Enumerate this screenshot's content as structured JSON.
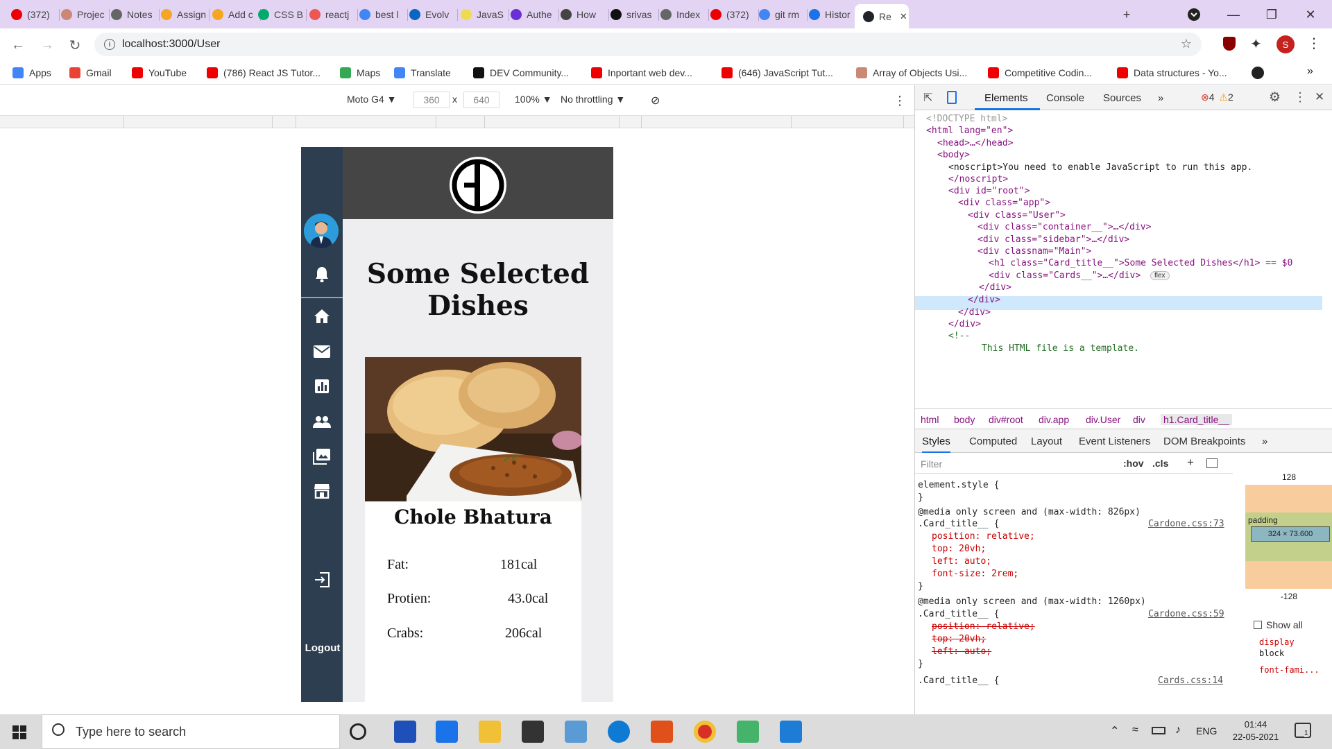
{
  "browser": {
    "tabs": [
      {
        "label": "(372)",
        "icon": "youtube-icon"
      },
      {
        "label": "Projec",
        "icon": "avatar-icon"
      },
      {
        "label": "Notes",
        "icon": "globe-icon"
      },
      {
        "label": "Assign",
        "icon": "flame-icon"
      },
      {
        "label": "Add c",
        "icon": "flame-icon"
      },
      {
        "label": "CSS B",
        "icon": "w3-icon"
      },
      {
        "label": "reactj",
        "icon": "rocket-icon"
      },
      {
        "label": "best l",
        "icon": "google-icon"
      },
      {
        "label": "Evolv",
        "icon": "linkedin-icon"
      },
      {
        "label": "JavaS",
        "icon": "js-icon"
      },
      {
        "label": "Authe",
        "icon": "auth-icon"
      },
      {
        "label": "How",
        "icon": "kite-icon"
      },
      {
        "label": "srivas",
        "icon": "github-icon"
      },
      {
        "label": "Index",
        "icon": "globe-icon"
      },
      {
        "label": "(372)",
        "icon": "youtube-icon"
      },
      {
        "label": "git rm",
        "icon": "google-icon"
      },
      {
        "label": "Histor",
        "icon": "history-icon"
      },
      {
        "label": "Re",
        "icon": "react-icon",
        "active": true
      }
    ],
    "url": "localhost:3000/User",
    "profile_initial": "S",
    "bookmarks": [
      {
        "label": "Apps",
        "icon": "apps-grid-icon"
      },
      {
        "label": "Gmail",
        "icon": "gmail-icon"
      },
      {
        "label": "YouTube",
        "icon": "youtube-icon"
      },
      {
        "label": "(786) React JS Tutor...",
        "icon": "youtube-icon"
      },
      {
        "label": "Maps",
        "icon": "maps-icon"
      },
      {
        "label": "Translate",
        "icon": "translate-icon"
      },
      {
        "label": "DEV Community...",
        "icon": "dev-icon"
      },
      {
        "label": "Inportant web dev...",
        "icon": "youtube-icon"
      },
      {
        "label": "(646) JavaScript Tut...",
        "icon": "youtube-icon"
      },
      {
        "label": "Array of Objects Usi...",
        "icon": "person-icon"
      },
      {
        "label": "Competitive Codin...",
        "icon": "youtube-icon"
      },
      {
        "label": "Data structures - Yo...",
        "icon": "youtube-icon"
      }
    ]
  },
  "device_toolbar": {
    "device": "Moto G4",
    "width": "360",
    "times": "x",
    "height": "640",
    "zoom": "100%",
    "throttle": "No throttling"
  },
  "app": {
    "logout_label": "Logout",
    "page_title": "Some Selected Dishes",
    "card": {
      "name": "Chole Bhatura",
      "rows": [
        {
          "label": "Fat:",
          "value": "181cal"
        },
        {
          "label": "Protien:",
          "value": "43.0cal"
        },
        {
          "label": "Crabs:",
          "value": "206cal"
        }
      ]
    }
  },
  "devtools": {
    "tabs": [
      "Elements",
      "Console",
      "Sources",
      "»"
    ],
    "errors": "4",
    "warnings": "2",
    "dom_lines": [
      "<!DOCTYPE html>",
      "<html lang=\"en\">",
      "<head>…</head>",
      "<body>",
      "<noscript>You need to enable JavaScript to run this app.",
      "</noscript>",
      "<div id=\"root\">",
      "<div class=\"app\">",
      "<div class=\"User\">",
      "<div class=\"container__\">…</div>",
      "<div class=\"sidebar\">…</div>",
      "<div classnam=\"Main\">",
      "<h1 class=\"Card_title__\">Some Selected Dishes</h1> == $0",
      "<div class=\"Cards__\">…</div>",
      "</div>",
      "</div>",
      "</div>",
      "</div>",
      "<!--",
      "This HTML file is a template."
    ],
    "flex_badge": "flex",
    "breadcrumbs": [
      "html",
      "body",
      "div#root",
      "div.app",
      "div.User",
      "div",
      "h1.Card_title__"
    ],
    "sub_tabs": [
      "Styles",
      "Computed",
      "Layout",
      "Event Listeners",
      "DOM Breakpoints",
      "»"
    ],
    "filter_placeholder": "Filter",
    "hov": ":hov",
    "cls": ".cls",
    "style_lines": [
      "element.style {",
      "}",
      "@media only screen and (max-width: 826px)",
      ".Card_title__ {",
      "position: relative;",
      "top: 20vh;",
      "left: auto;",
      "font-size: 2rem;",
      "}",
      "@media only screen and (max-width: 1260px)",
      ".Card_title__ {",
      "position: relative;",
      "top: 20vh;",
      "left: auto;",
      "}",
      ".Card_title__ {"
    ],
    "style_sources": [
      "Cardone.css:73",
      "Cardone.css:59",
      "Cards.css:14"
    ],
    "box_model": {
      "top": "128",
      "bottom": "-128",
      "content": "324 × 73.600",
      "padding_label": "padding"
    },
    "show_all": "Show all",
    "computed": [
      "display",
      "block",
      "font-fami..."
    ]
  },
  "taskbar": {
    "search_placeholder": "Type here to search",
    "lang": "ENG",
    "time": "01:44",
    "date": "22-05-2021",
    "notifications": "1"
  }
}
